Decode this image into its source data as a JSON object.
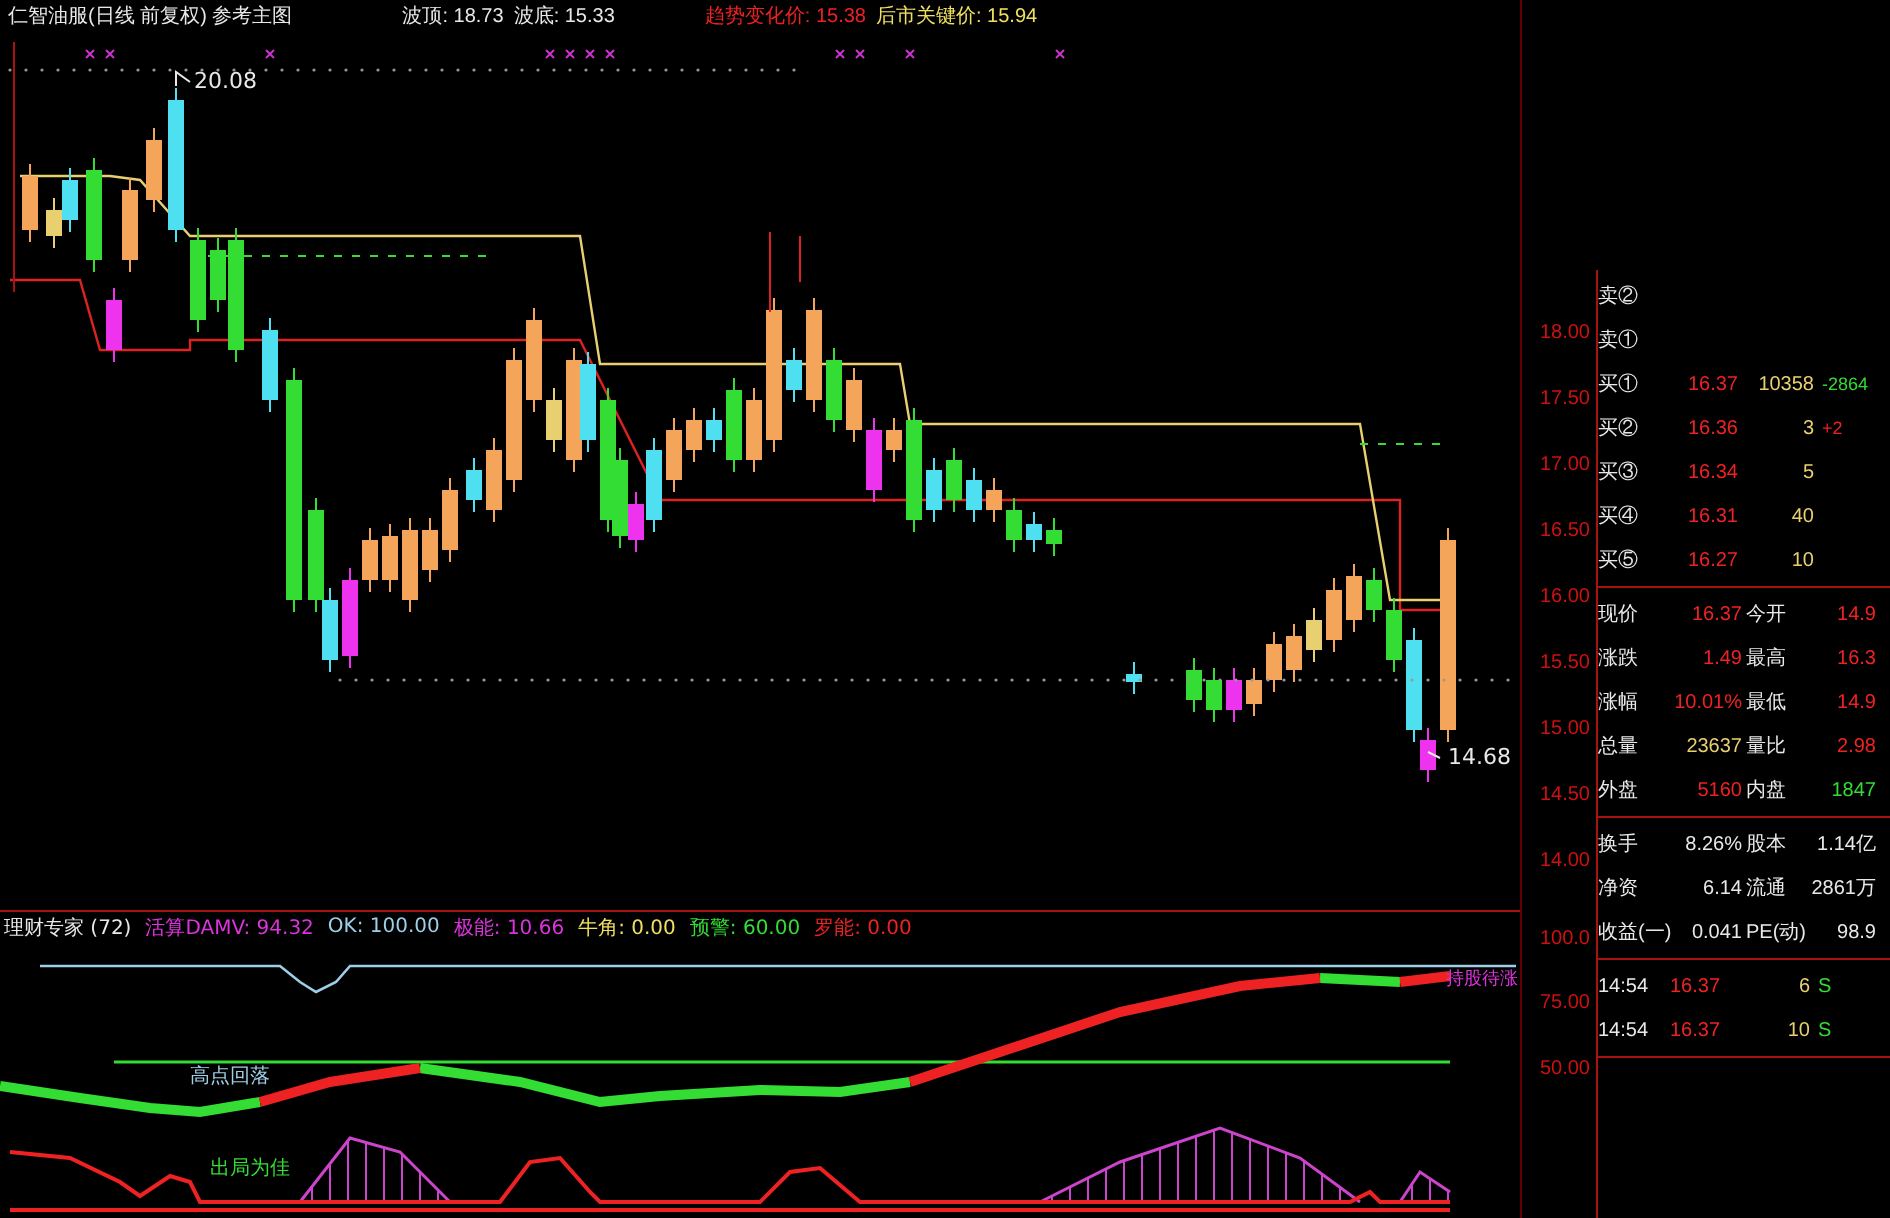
{
  "header": [
    {
      "text": "仁智油服(日线 前复权) 参考主图",
      "color": "#e8e8e8"
    },
    {
      "text": "波顶: 18.73",
      "color": "#e8e8e8"
    },
    {
      "text": "波底: 15.33",
      "color": "#e8e8e8"
    },
    {
      "text": "趋势变化价: 15.38",
      "color": "#ee2222"
    },
    {
      "text": "后市关键价: 15.94",
      "color": "#f0e060"
    }
  ],
  "chart_labels": {
    "high": "20.08",
    "low": "14.68"
  },
  "price_axis": [
    "18.00",
    "17.50",
    "17.00",
    "16.50",
    "16.00",
    "15.50",
    "15.00",
    "14.50",
    "14.00"
  ],
  "indicator": {
    "items": [
      {
        "text": "理财专家 (72)",
        "color": "#e8e8e8"
      },
      {
        "text": "活算DAMV: 94.32",
        "color": "#dd33dd"
      },
      {
        "text": "OK: 100.00",
        "color": "#9ecfe8"
      },
      {
        "text": "极能: 10.66",
        "color": "#dd33dd"
      },
      {
        "text": "牛角: 0.00",
        "color": "#f0e060"
      },
      {
        "text": "预警: 60.00",
        "color": "#33dd33"
      },
      {
        "text": "罗能: 0.00",
        "color": "#ee2222"
      }
    ],
    "labels": [
      {
        "text": "高点回落",
        "color": "#9ecfe8"
      },
      {
        "text": "出局为佳",
        "color": "#33dd33"
      },
      {
        "text": "持股待涨",
        "color": "#dd33dd"
      }
    ],
    "axis": [
      "100.0",
      "75.00",
      "50.00"
    ]
  },
  "order_book": [
    {
      "label": "卖②"
    },
    {
      "label": "卖①"
    },
    {
      "label": "买①",
      "price": "16.37",
      "volume": "10358",
      "change": {
        "text": "-2864",
        "color": "#33dd33"
      }
    },
    {
      "label": "买②",
      "price": "16.36",
      "volume": "3",
      "change": {
        "text": "+2",
        "color": "#ee2222"
      }
    },
    {
      "label": "买③",
      "price": "16.34",
      "volume": "5"
    },
    {
      "label": "买④",
      "price": "16.31",
      "volume": "40"
    },
    {
      "label": "买⑤",
      "price": "16.27",
      "volume": "10"
    }
  ],
  "quote_groups": [
    [
      [
        {
          "label": "现价",
          "value": "16.37",
          "color": "#ee2222"
        },
        {
          "label": "今开",
          "value": "14.9",
          "color": "#ee2222"
        }
      ],
      [
        {
          "label": "涨跌",
          "value": "1.49",
          "color": "#ee2222"
        },
        {
          "label": "最高",
          "value": "16.3",
          "color": "#ee2222"
        }
      ],
      [
        {
          "label": "涨幅",
          "value": "10.01%",
          "color": "#ee2222"
        },
        {
          "label": "最低",
          "value": "14.9",
          "color": "#ee2222"
        }
      ],
      [
        {
          "label": "总量",
          "value": "23637",
          "color": "#e8d070"
        },
        {
          "label": "量比",
          "value": "2.98",
          "color": "#ee2222"
        }
      ],
      [
        {
          "label": "外盘",
          "value": "5160",
          "color": "#ee2222"
        },
        {
          "label": "内盘",
          "value": "1847",
          "color": "#33dd33"
        }
      ]
    ],
    [
      [
        {
          "label": "换手",
          "value": "8.26%",
          "color": "#e8e8e8"
        },
        {
          "label": "股本",
          "value": "1.14亿",
          "color": "#e8e8e8"
        }
      ],
      [
        {
          "label": "净资",
          "value": "6.14",
          "color": "#e8e8e8"
        },
        {
          "label": "流通",
          "value": "2861万",
          "color": "#e8e8e8"
        }
      ],
      [
        {
          "label": "收益(一)",
          "value": "0.041",
          "color": "#e8e8e8"
        },
        {
          "label": "PE(动)",
          "value": "98.9",
          "color": "#e8e8e8"
        }
      ]
    ]
  ],
  "trades": [
    {
      "time": "14:54",
      "price": "16.37",
      "volume": "6",
      "side": "S"
    },
    {
      "time": "14:54",
      "price": "16.37",
      "volume": "10",
      "side": "S"
    }
  ]
}
